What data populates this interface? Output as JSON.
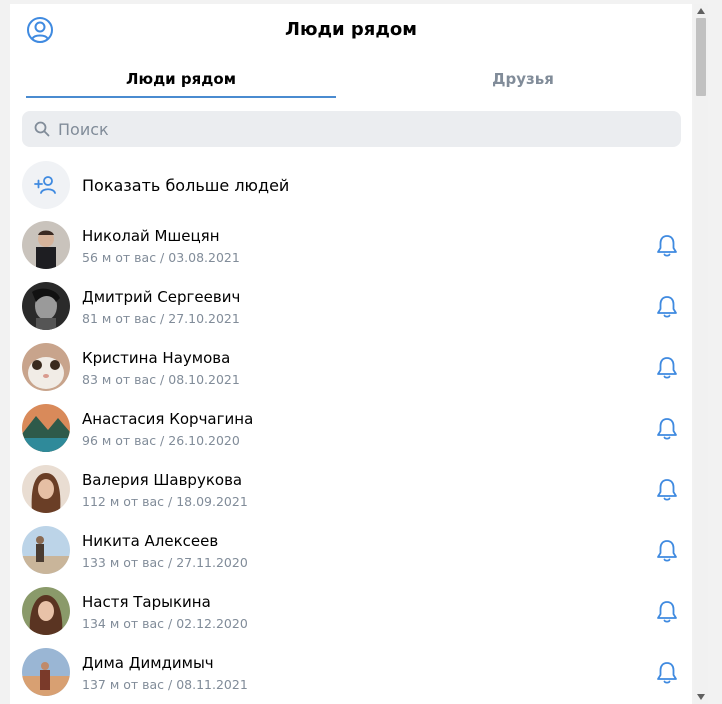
{
  "header": {
    "title": "Люди рядом",
    "profile_icon": "user-circle-icon"
  },
  "tabs": [
    {
      "label": "Люди рядом",
      "active": true
    },
    {
      "label": "Друзья",
      "active": false
    }
  ],
  "search": {
    "placeholder": "Поиск",
    "icon": "search-icon"
  },
  "show_more": {
    "label": "Показать больше людей",
    "icon": "add-user-icon"
  },
  "people": [
    {
      "name": "Николай Мшецян",
      "meta": "56 м от вас / 03.08.2021",
      "icon": "bell-icon"
    },
    {
      "name": "Дмитрий Сергеевич",
      "meta": "81 м от вас / 27.10.2021",
      "icon": "bell-icon"
    },
    {
      "name": "Кристина Наумова",
      "meta": "83 м от вас / 08.10.2021",
      "icon": "bell-icon"
    },
    {
      "name": "Анастасия Корчагина",
      "meta": "96 м от вас / 26.10.2020",
      "icon": "bell-icon"
    },
    {
      "name": "Валерия Шаврукова",
      "meta": "112 м от вас / 18.09.2021",
      "icon": "bell-icon"
    },
    {
      "name": "Никита Алексеев",
      "meta": "133 м от вас / 27.11.2020",
      "icon": "bell-icon"
    },
    {
      "name": "Настя Тарыкина",
      "meta": "134 м от вас / 02.12.2020",
      "icon": "bell-icon"
    },
    {
      "name": "Дима Димдимыч",
      "meta": "137 м от вас / 08.11.2021",
      "icon": "bell-icon"
    }
  ],
  "colors": {
    "accent": "#3f8ae0",
    "secondary_text": "#818c99",
    "search_bg": "#ebedf0"
  }
}
